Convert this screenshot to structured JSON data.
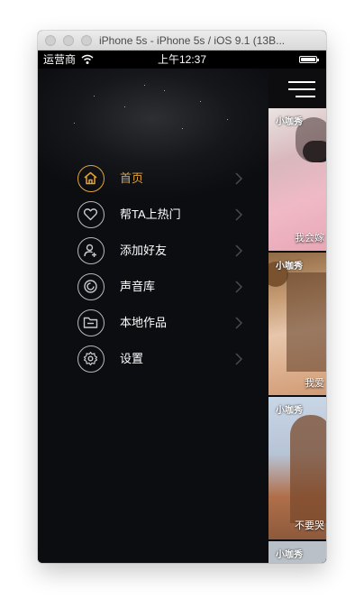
{
  "window": {
    "title": "iPhone 5s - iPhone 5s / iOS 9.1 (13B..."
  },
  "status_bar": {
    "carrier": "运营商",
    "time": "上午12:37",
    "battery_level": 1.0
  },
  "drawer": {
    "accent_color": "#e0a33a",
    "items": [
      {
        "label": "首页",
        "icon": "home-icon",
        "active": true
      },
      {
        "label": "帮TA上热门",
        "icon": "heart-icon",
        "active": false
      },
      {
        "label": "添加好友",
        "icon": "add-friend-icon",
        "active": false
      },
      {
        "label": "声音库",
        "icon": "sound-library-icon",
        "active": false
      },
      {
        "label": "本地作品",
        "icon": "folder-icon",
        "active": false
      },
      {
        "label": "设置",
        "icon": "gear-icon",
        "active": false
      }
    ]
  },
  "feed": {
    "menu_icon": "hamburger-menu-icon",
    "thumbnails": [
      {
        "logo": "小咖秀",
        "caption": "我会嫁"
      },
      {
        "logo": "小咖秀",
        "caption": "我爱"
      },
      {
        "logo": "小咖秀",
        "caption": "不要哭"
      },
      {
        "logo": "小咖秀",
        "caption": ""
      }
    ]
  }
}
